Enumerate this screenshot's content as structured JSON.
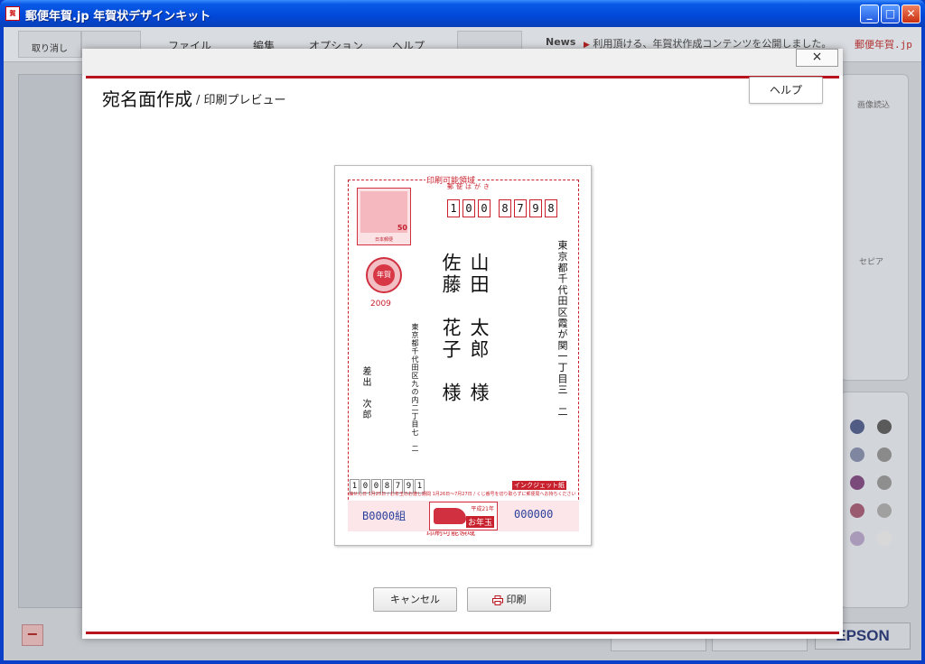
{
  "window": {
    "title": "郵便年賀.jp 年賀状デザインキット",
    "icon_name": "app-logo-icon"
  },
  "app": {
    "toolbar": {
      "undo_label": "取り消し",
      "menu": [
        "ファイル",
        "編集",
        "オプション",
        "ヘルプ"
      ]
    },
    "news": {
      "label": "News",
      "text": "利用頂ける、年賀状作成コンテンツを公開しました。"
    },
    "brand": "郵便年賀.jp",
    "side": {
      "image_load": "画像読込",
      "sepia": "セピア"
    },
    "footer": {
      "epson": "EPSON"
    },
    "swatches": [
      "#505c84",
      "#5a5a5a",
      "#7f86a0",
      "#8a8a8a",
      "#7a4a7a",
      "#8e8e8e",
      "#9a5a70",
      "#a0a0a0",
      "#a89ab8",
      "#d8d8d8"
    ]
  },
  "dialog": {
    "title": "宛名面作成",
    "subtitle": "/ 印刷プレビュー",
    "help_label": "ヘルプ",
    "close_label": "×",
    "cancel_label": "キャンセル",
    "print_label": "印刷"
  },
  "postcard": {
    "printable_area_label": "印刷可能領域",
    "header": "郵便はがき",
    "zip": [
      "1",
      "0",
      "0",
      "8",
      "7",
      "9",
      "8"
    ],
    "recipient_address": "東京都千代田区霞が関一丁目三　二",
    "recipient_name_line1": "山田　太郎　様",
    "recipient_name_line2": "佐藤　花子　様",
    "sender_address": "東京都千代田区九の内二丁目七　二",
    "sender_name": "差出　次郎",
    "sender_zip": [
      "1",
      "0",
      "0",
      "8",
      "7",
      "9",
      "1"
    ],
    "postmark_text": "年賀",
    "year": "2009",
    "stamp_value": "50",
    "stamp_label": "日本郵便",
    "inkjet_label": "インクジェット紙",
    "lottery_note": "抽せん日 1月25日 / お年玉のお渡し期間 1月26日～7月27日 / くじ番号を切り取らずに郵便局へお持ちください",
    "kumi": "B0000組",
    "lottery_number": "000000",
    "otoshidama_year": "平成21年",
    "otoshidama_label": "お年玉"
  },
  "colors": {
    "accent_red": "#b8141e",
    "card_red": "#c8202c",
    "lottery_blue": "#2a3f9a"
  }
}
